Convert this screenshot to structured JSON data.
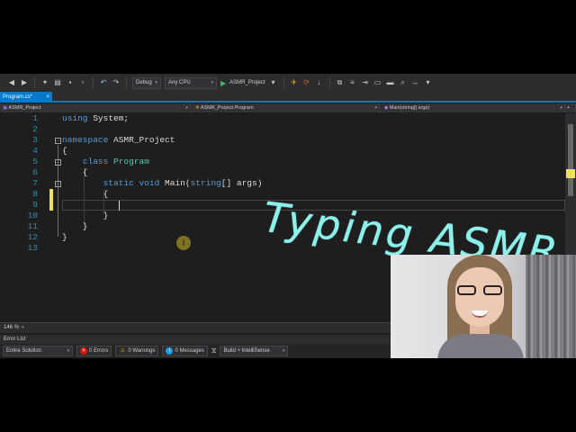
{
  "toolbar": {
    "config_label": "Debug",
    "platform_label": "Any CPU",
    "start_label": "ASMR_Project",
    "icons": [
      "back-icon",
      "forward-icon",
      "new-project-icon",
      "open-icon",
      "save-icon",
      "save-all-icon",
      "undo-icon",
      "redo-icon",
      "start-icon",
      "browser-link-icon",
      "hot-reload-icon",
      "bookmark-icon",
      "comment-icon",
      "uncomment-icon"
    ]
  },
  "tab": {
    "label": "Program.cs*",
    "pin": "⊞",
    "close": "×"
  },
  "navbar": {
    "project": "ASMR_Project",
    "class": "ASMR_Project.Program",
    "member": "Main(string[] args)"
  },
  "editor": {
    "lines": [
      {
        "n": "1",
        "parts": [
          [
            "kw",
            "using"
          ],
          [
            "pl",
            " System;"
          ]
        ]
      },
      {
        "n": "2",
        "parts": []
      },
      {
        "n": "3",
        "parts": [
          [
            "kw",
            "namespace"
          ],
          [
            "pl",
            " ASMR_Project"
          ]
        ]
      },
      {
        "n": "4",
        "parts": [
          [
            "pl",
            "{"
          ]
        ]
      },
      {
        "n": "5",
        "parts": [
          [
            "pl",
            "    "
          ],
          [
            "kw",
            "class"
          ],
          [
            "pl",
            " "
          ],
          [
            "ty",
            "Program"
          ]
        ]
      },
      {
        "n": "6",
        "parts": [
          [
            "pl",
            "    {"
          ]
        ]
      },
      {
        "n": "7",
        "parts": [
          [
            "pl",
            "        "
          ],
          [
            "kw",
            "static"
          ],
          [
            "pl",
            " "
          ],
          [
            "kw",
            "void"
          ],
          [
            "pl",
            " Main("
          ],
          [
            "kw",
            "string"
          ],
          [
            "pl",
            "[] args)"
          ]
        ]
      },
      {
        "n": "8",
        "parts": [
          [
            "pl",
            "        {"
          ]
        ]
      },
      {
        "n": "9",
        "parts": []
      },
      {
        "n": "10",
        "parts": [
          [
            "pl",
            "        }"
          ]
        ]
      },
      {
        "n": "11",
        "parts": [
          [
            "pl",
            "    }"
          ]
        ]
      },
      {
        "n": "12",
        "parts": [
          [
            "pl",
            "}"
          ]
        ]
      },
      {
        "n": "13",
        "parts": []
      }
    ]
  },
  "overlay_text": "Typing ASMR",
  "zoom": {
    "value": "146 %"
  },
  "error_list": {
    "title": "Error List",
    "scope": "Entire Solution",
    "errors": "0 Errors",
    "warnings": "0 Warnings",
    "messages": "0 Messages",
    "source": "Build + IntelliSense"
  },
  "colors": {
    "accent": "#007acc",
    "keyword": "#569cd6",
    "type": "#4ec9b0",
    "line_number": "#2b91af",
    "overlay": "#8ef0ea",
    "change_bar": "#efe25a"
  }
}
